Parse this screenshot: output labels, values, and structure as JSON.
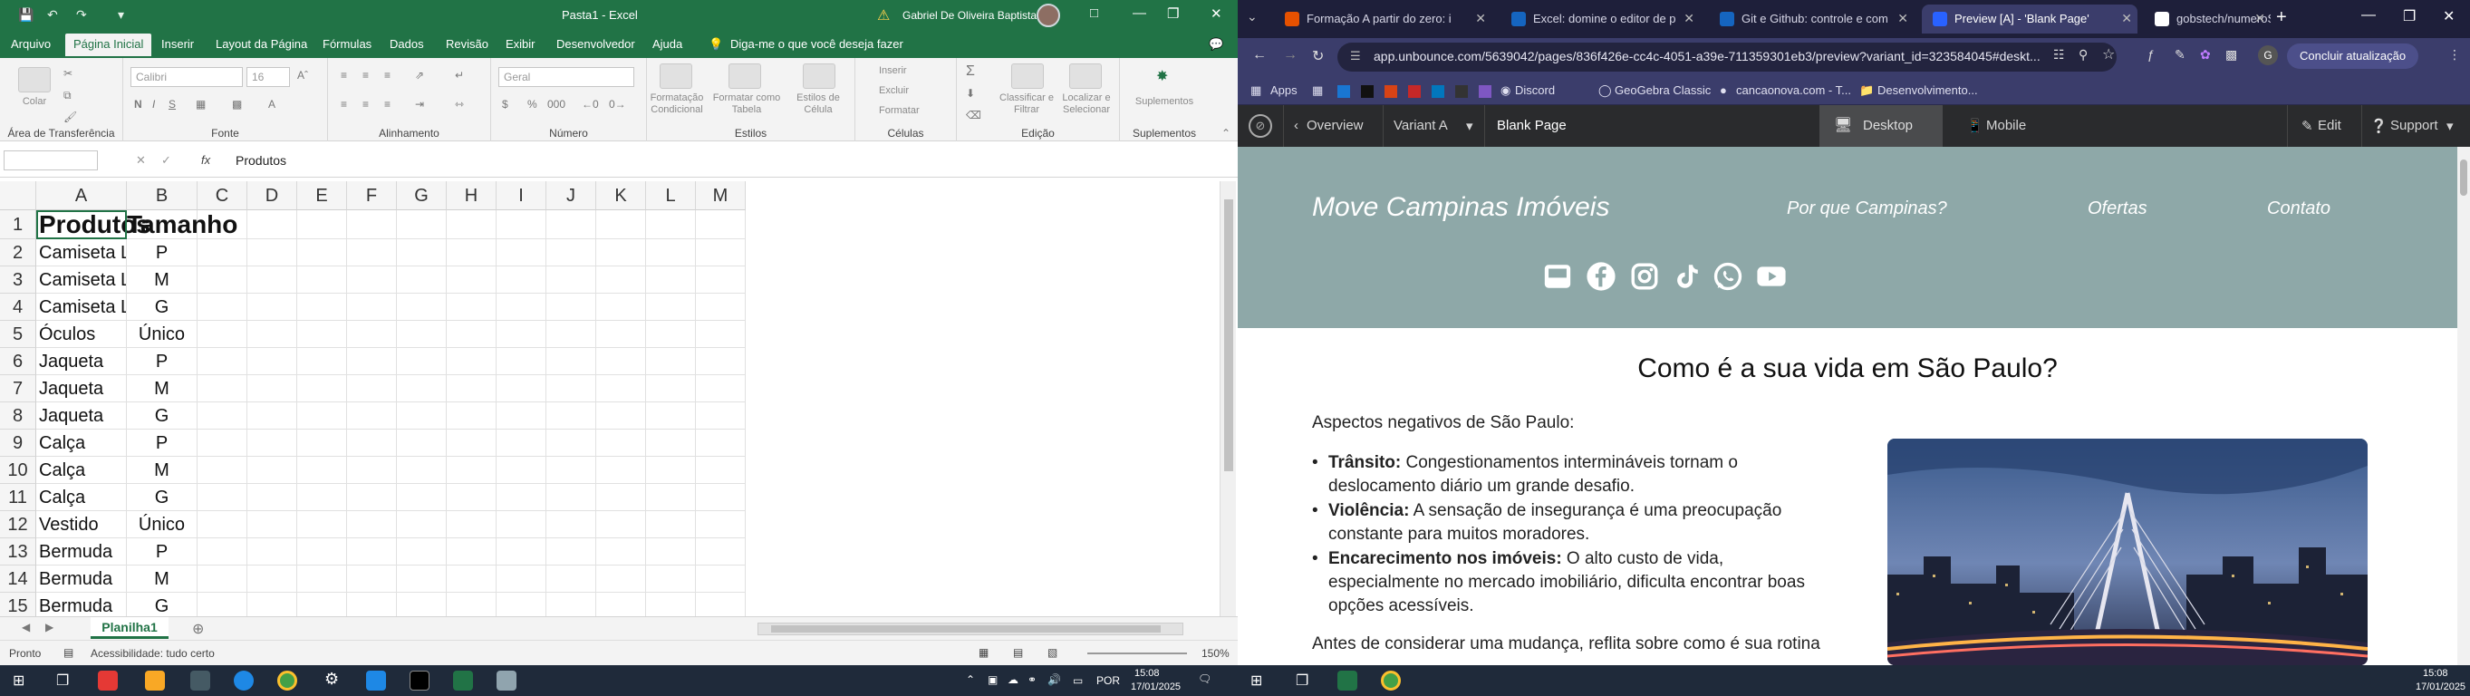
{
  "excel": {
    "title": "Pasta1 - Excel",
    "user": "Gabriel De Oliveira Baptista",
    "tabs": [
      "Arquivo",
      "Página Inicial",
      "Inserir",
      "Layout da Página",
      "Fórmulas",
      "Dados",
      "Revisão",
      "Exibir",
      "Desenvolvedor",
      "Ajuda"
    ],
    "tell_me": "Diga-me o que você deseja fazer",
    "ribbon": {
      "clipboard": {
        "label": "Área de Transferência",
        "paste": "Colar"
      },
      "font": {
        "label": "Fonte",
        "font_name": "Calibri",
        "font_size": "16",
        "bold": "N",
        "italic": "I",
        "underline": "S"
      },
      "alignment": {
        "label": "Alinhamento"
      },
      "number": {
        "label": "Número",
        "format": "Geral",
        "percent": "%",
        "thousands": "000"
      },
      "styles": {
        "label": "Estilos",
        "cond_format": "Formatação Condicional",
        "format_table": "Formatar como Tabela",
        "cell_styles": "Estilos de Célula"
      },
      "cells": {
        "label": "Células",
        "insert": "Inserir",
        "delete": "Excluir",
        "format": "Formatar"
      },
      "editing": {
        "label": "Edição",
        "sort": "Classificar e Filtrar",
        "find": "Localizar e Selecionar"
      },
      "addins": {
        "label": "Suplementos",
        "btn": "Suplementos"
      }
    },
    "formula_bar": {
      "name_box": "",
      "fx": "fx",
      "value": "Produtos"
    },
    "columns": [
      "A",
      "B",
      "C",
      "D",
      "E",
      "F",
      "G",
      "H",
      "I",
      "J",
      "K",
      "L",
      "M"
    ],
    "rows": [
      {
        "n": "1",
        "a": "Produtos",
        "b": "Tamanho"
      },
      {
        "n": "2",
        "a": "Camiseta Lisa",
        "b": "P"
      },
      {
        "n": "3",
        "a": "Camiseta Lisa",
        "b": "M"
      },
      {
        "n": "4",
        "a": "Camiseta Lisa",
        "b": "G"
      },
      {
        "n": "5",
        "a": "Óculos",
        "b": "Único"
      },
      {
        "n": "6",
        "a": "Jaqueta",
        "b": "P"
      },
      {
        "n": "7",
        "a": "Jaqueta",
        "b": "M"
      },
      {
        "n": "8",
        "a": "Jaqueta",
        "b": "G"
      },
      {
        "n": "9",
        "a": "Calça",
        "b": "P"
      },
      {
        "n": "10",
        "a": "Calça",
        "b": "M"
      },
      {
        "n": "11",
        "a": "Calça",
        "b": "G"
      },
      {
        "n": "12",
        "a": "Vestido",
        "b": "Único"
      },
      {
        "n": "13",
        "a": "Bermuda",
        "b": "P"
      },
      {
        "n": "14",
        "a": "Bermuda",
        "b": "M"
      },
      {
        "n": "15",
        "a": "Bermuda",
        "b": "G"
      }
    ],
    "sheet_tab": "Planilha1",
    "status": {
      "ready": "Pronto",
      "accessibility": "Acessibilidade: tudo certo",
      "zoom": "150%"
    }
  },
  "chrome": {
    "tabs": [
      {
        "label": "Formação A partir do zero: i",
        "color": "#e65100"
      },
      {
        "label": "Excel: domine o editor de p",
        "color": "#1565c0"
      },
      {
        "label": "Git e Github: controle e com",
        "color": "#1565c0"
      },
      {
        "label": "Preview [A] - 'Blank Page'",
        "color": "#2962ff"
      },
      {
        "label": "gobstech/numeroSecretoAl",
        "color": "#ffffff"
      }
    ],
    "url": "app.unbounce.com/5639042/pages/836f426e-cc4c-4051-a39e-711359301eb3/preview?variant_id=323584045#deskt...",
    "update_btn": "Concluir atualização",
    "profile": "G",
    "bookmarks": [
      "Apps",
      "Discord",
      "GeoGebra Classic",
      "cancaonova.com - T...",
      "Desenvolvimento..."
    ],
    "unbounce": {
      "overview": "Overview",
      "variant": "Variant A",
      "page": "Blank Page",
      "desktop": "Desktop",
      "mobile": "Mobile",
      "edit": "Edit",
      "support": "Support"
    }
  },
  "site": {
    "logo": "Move Campinas Imóveis",
    "nav": [
      "Por que Campinas?",
      "Ofertas",
      "Contato"
    ],
    "social": [
      "inbox-icon",
      "facebook-icon",
      "instagram-icon",
      "tiktok-icon",
      "whatsapp-icon",
      "youtube-icon"
    ],
    "heading": "Como é a sua vida em São Paulo?",
    "intro": "Aspectos negativos de São Paulo:",
    "bullets": [
      {
        "bold": "Trânsito:",
        "text": " Congestionamentos intermináveis tornam o deslocamento diário um grande desafio."
      },
      {
        "bold": "Violência:",
        "text": " A sensação de insegurança é uma preocupação constante para muitos moradores."
      },
      {
        "bold": "Encarecimento nos imóveis:",
        "text": " O alto custo de vida, especialmente no mercado imobiliário, dificulta encontrar boas opções acessíveis."
      }
    ],
    "outro": "Antes de considerar uma mudança, reflita sobre como é sua rotina",
    "colors": {
      "hero": "#8ea8a8"
    }
  },
  "taskbar": {
    "left_clock": {
      "time": "15:08",
      "date": "17/01/2025"
    },
    "lang": "POR",
    "right_clock": {
      "time": "15:08",
      "date": "17/01/2025"
    }
  }
}
